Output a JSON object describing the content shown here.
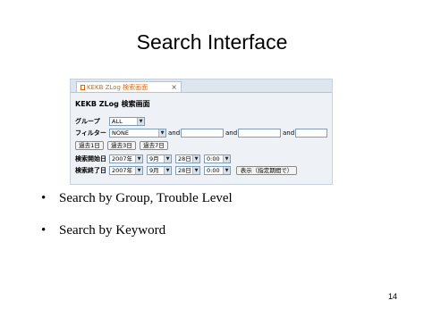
{
  "slide": {
    "title": "Search Interface",
    "page_number": "14",
    "bullets": [
      "Search by Group,  Trouble Level",
      "Search by Keyword"
    ]
  },
  "screenshot": {
    "tab_title": "KEKB ZLog 検索画面",
    "tab_close": "×",
    "app_title": "KEKB ZLog 検索画面",
    "group": {
      "label": "グループ",
      "selected": "ALL"
    },
    "filter": {
      "label": "フィルター",
      "selected": "NONE",
      "and_label": "and"
    },
    "quick_buttons": [
      "過去1日",
      "過去3日",
      "過去7日"
    ],
    "start": {
      "label": "検索開始日",
      "year": "2007年",
      "month": "9月",
      "day": "28日",
      "time": "0:00"
    },
    "end": {
      "label": "検索終了日",
      "year": "2007年",
      "month": "9月",
      "day": "28日",
      "time": "0:00"
    },
    "display_button": "表示（指定期間で）"
  },
  "icons": {
    "bullet": "•",
    "dropdown_arrow": "▼"
  }
}
